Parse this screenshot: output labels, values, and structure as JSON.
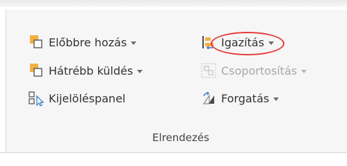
{
  "ribbon": {
    "group_label": "Elrendezés",
    "commands": {
      "bring_forward": {
        "label": "Előbbre hozás",
        "icon": "bring-forward-icon"
      },
      "send_backward": {
        "label": "Hátrébb küldés",
        "icon": "send-backward-icon"
      },
      "selection_pane": {
        "label": "Kijelöléspanel",
        "icon": "selection-pane-icon"
      },
      "align": {
        "label": "Igazítás",
        "icon": "align-icon"
      },
      "group": {
        "label": "Csoportosítás",
        "icon": "group-icon",
        "disabled": true
      },
      "rotate": {
        "label": "Forgatás",
        "icon": "rotate-icon"
      }
    }
  },
  "colors": {
    "highlight_ring": "#e33a3a",
    "icon_orange": "#f3b042",
    "icon_blue": "#2e75c8"
  }
}
